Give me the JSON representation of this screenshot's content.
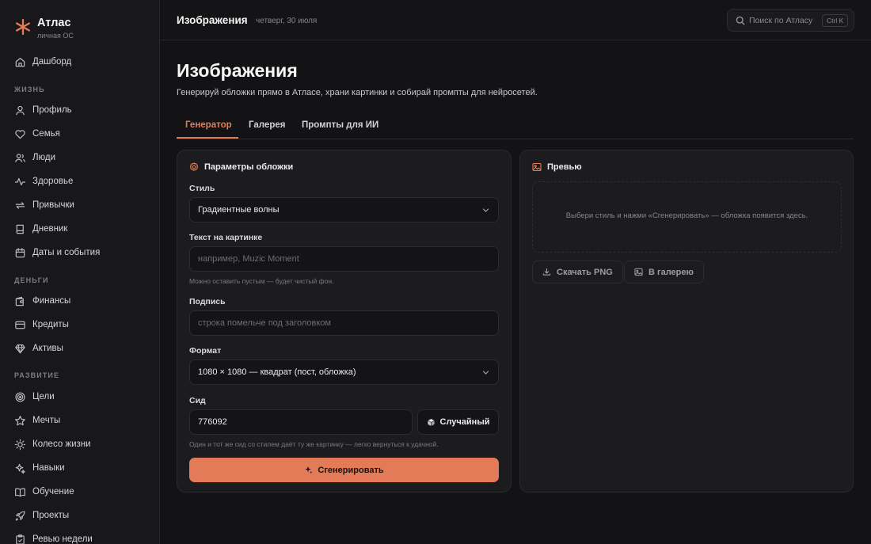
{
  "brand": {
    "name": "Атлас",
    "subtitle": "личная ОС",
    "logo_icon": "asterisk-logo-icon",
    "accent": "#e57c57"
  },
  "topbar": {
    "title": "Изображения",
    "date": "четверг, 30 июля",
    "search": {
      "placeholder": "Поиск по Атласу",
      "shortcut": "Ctrl K",
      "icon": "search-icon"
    }
  },
  "sidebar": {
    "top_item": {
      "label": "Дашборд",
      "icon": "home-icon"
    },
    "sections": [
      {
        "title": "ЖИЗНЬ",
        "items": [
          {
            "label": "Профиль",
            "icon": "user-icon"
          },
          {
            "label": "Семья",
            "icon": "heart-icon"
          },
          {
            "label": "Люди",
            "icon": "users-icon"
          },
          {
            "label": "Здоровье",
            "icon": "activity-icon"
          },
          {
            "label": "Привычки",
            "icon": "repeat-icon"
          },
          {
            "label": "Дневник",
            "icon": "book-icon"
          },
          {
            "label": "Даты и события",
            "icon": "calendar-icon"
          }
        ]
      },
      {
        "title": "ДЕНЬГИ",
        "items": [
          {
            "label": "Финансы",
            "icon": "wallet-icon"
          },
          {
            "label": "Кредиты",
            "icon": "credit-card-icon"
          },
          {
            "label": "Активы",
            "icon": "gem-icon"
          }
        ]
      },
      {
        "title": "РАЗВИТИЕ",
        "items": [
          {
            "label": "Цели",
            "icon": "target-icon"
          },
          {
            "label": "Мечты",
            "icon": "star-icon"
          },
          {
            "label": "Колесо жизни",
            "icon": "sun-icon"
          },
          {
            "label": "Навыки",
            "icon": "sparkles-icon"
          },
          {
            "label": "Обучение",
            "icon": "open-book-icon"
          },
          {
            "label": "Проекты",
            "icon": "rocket-icon"
          },
          {
            "label": "Ревью недели",
            "icon": "clipboard-icon"
          }
        ]
      }
    ]
  },
  "page": {
    "title": "Изображения",
    "subtitle": "Генерируй обложки прямо в Атласе, храни картинки и собирай промпты для нейросетей.",
    "tabs": [
      {
        "label": "Генератор",
        "active": true
      },
      {
        "label": "Галерея",
        "active": false
      },
      {
        "label": "Промпты для ИИ",
        "active": false
      }
    ]
  },
  "params": {
    "title": "Параметры обложки",
    "icon": "gear-icon",
    "style": {
      "label": "Стиль",
      "value": "Градиентные волны"
    },
    "text": {
      "label": "Текст на картинке",
      "placeholder": "например, Muzic Moment",
      "hint": "Можно оставить пустым — будет чистый фон."
    },
    "caption": {
      "label": "Подпись",
      "placeholder": "строка помельче под заголовком"
    },
    "format": {
      "label": "Формат",
      "value": "1080 × 1080 — квадрат (пост, обложка)"
    },
    "seed": {
      "label": "Сид",
      "value": "776092",
      "random_label": "Случайный",
      "hint": "Один и тот же сид со стилем даёт ту же картинку — легко вернуться к удачной."
    },
    "generate_label": "Сгенерировать"
  },
  "preview": {
    "title": "Превью",
    "icon": "image-icon",
    "empty_text": "Выбери стиль и нажми «Сгенерировать» — обложка появится здесь.",
    "download_label": "Скачать PNG",
    "gallery_label": "В галерею"
  }
}
